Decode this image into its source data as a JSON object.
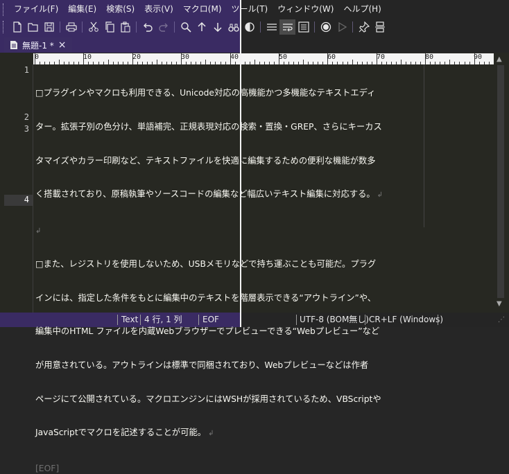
{
  "menu": [
    "ファイル(F)",
    "編集(E)",
    "検索(S)",
    "表示(V)",
    "マクロ(M)",
    "ツール(T)",
    "ウィンドウ(W)",
    "ヘルプ(H)"
  ],
  "toolbar_icons": [
    "new-file-icon",
    "open-folder-icon",
    "save-icon",
    "print-icon",
    "cut-icon",
    "copy-icon",
    "paste-icon",
    "undo-icon",
    "redo-icon",
    "search-icon",
    "find-next-up-icon",
    "find-next-down-icon",
    "binoculars-icon",
    "sidebar-icon",
    "word-wrap-icon",
    "wrap-window-icon",
    "macro-record-icon",
    "macro-play-icon",
    "pin-icon",
    "split-icon"
  ],
  "tab": {
    "title": "無題-1 *",
    "close": "×"
  },
  "ruler": [
    "0",
    "10",
    "20",
    "30",
    "40",
    "50",
    "60",
    "70",
    "80",
    "90"
  ],
  "line_numbers": [
    "1",
    "2",
    "3",
    "4"
  ],
  "document": {
    "para1": [
      "□プラグインやマクロも利用できる、Unicode対応の高機能かつ多機能なテキストエディ",
      "ター。拡張子別の色分け、単語補完、正規表現対応の検索・置換・GREP、さらにキーカス",
      "タマイズやカラー印刷など、テキストファイルを快適に編集するための便利な機能が数多",
      "く搭載されており、原稿執筆やソースコードの編集など幅広いテキスト編集に対応する。"
    ],
    "para3": [
      "□また、レジストリを使用しないため、USBメモリなどで持ち運ぶことも可能だ。プラグ",
      "インには、指定した条件をもとに編集中のテキストを階層表示できる“アウトライン”や、",
      "編集中のHTML ファイルを内蔵Webブラウザーでプレビューできる“Webプレビュー”など",
      "が用意されている。アウトラインは標準で同梱されており、Webプレビューなどは作者",
      "ページにて公開されている。マクロエンジンにはWSHが採用されているため、VBScriptや",
      "JavaScriptでマクロを記述することが可能。"
    ],
    "eof": "[EOF]"
  },
  "status": {
    "mode": "Text",
    "position": "4 行, 1 列",
    "eof": "EOF",
    "encoding": "UTF-8 (BOM無し)",
    "newline": "CR+LF (Windows)"
  }
}
